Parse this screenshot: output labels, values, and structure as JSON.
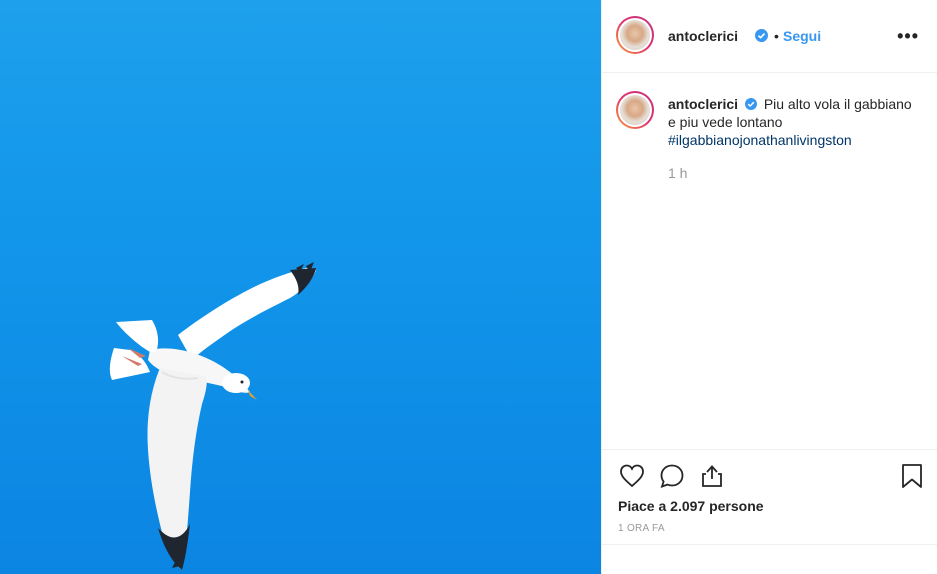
{
  "header": {
    "username": "antoclerici",
    "separator": "•",
    "follow_label": "Segui",
    "more_label": "•••"
  },
  "caption": {
    "username": "antoclerici",
    "text": "Piu alto vola il gabbiano e piu vede lontano",
    "hashtag": "#ilgabbianojonathanlivingston",
    "time": "1 h"
  },
  "actions": {
    "likes": "Piace a 2.097 persone",
    "post_time": "1 ORA FA"
  },
  "colors": {
    "sky": "#1296ea",
    "link": "#3897f0",
    "hashtag": "#003569",
    "verified": "#3897f0"
  },
  "icons": [
    "verified-badge-icon",
    "heart-icon",
    "comment-icon",
    "share-icon",
    "bookmark-icon",
    "more-icon"
  ]
}
